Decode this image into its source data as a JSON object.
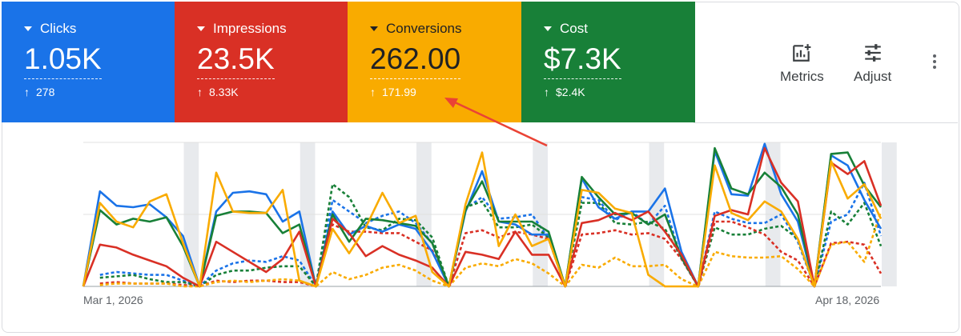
{
  "tiles": [
    {
      "label": "Clicks",
      "value": "1.05K",
      "delta": "278",
      "color": "#1a73e8"
    },
    {
      "label": "Impressions",
      "value": "23.5K",
      "delta": "8.33K",
      "color": "#d93025"
    },
    {
      "label": "Conversions",
      "value": "262.00",
      "delta": "171.99",
      "color": "#f9ab00"
    },
    {
      "label": "Cost",
      "value": "$7.3K",
      "delta": "$2.4K",
      "color": "#188038"
    }
  ],
  "toolbar": {
    "metrics_label": "Metrics",
    "adjust_label": "Adjust",
    "metrics_icon": "metrics-add-icon",
    "adjust_icon": "tune-icon",
    "more_icon": "more-vert-icon"
  },
  "chart_data": {
    "type": "line",
    "x_start_label": "Mar 1, 2026",
    "x_end_label": "Apr 18, 2026",
    "points": 49,
    "grid": true,
    "shaded_bands": "weekends",
    "series": [
      {
        "color": "#1a73e8",
        "style": "solid",
        "values": [
          0,
          0.66,
          0.56,
          0.55,
          0.57,
          0.48,
          0.35,
          0,
          0.52,
          0.65,
          0.66,
          0.64,
          0.45,
          0.52,
          0,
          0.52,
          0.36,
          0.42,
          0.38,
          0.43,
          0.4,
          0.24,
          0,
          0.52,
          0.8,
          0.45,
          0.43,
          0.36,
          0.36,
          0,
          0.75,
          0.55,
          0.47,
          0.52,
          0.52,
          0.68,
          0.24,
          0,
          0.94,
          0.64,
          0.63,
          0.99,
          0.64,
          0.45,
          0,
          0.91,
          0.84,
          0.6,
          0.4
        ]
      },
      {
        "color": "#188038",
        "style": "solid",
        "values": [
          0,
          0.53,
          0.43,
          0.47,
          0.45,
          0.48,
          0.28,
          0,
          0.49,
          0.52,
          0.52,
          0.51,
          0.37,
          0.43,
          0,
          0.5,
          0.31,
          0.47,
          0.46,
          0.44,
          0.42,
          0.3,
          0,
          0.53,
          0.73,
          0.45,
          0.45,
          0.45,
          0.38,
          0,
          0.76,
          0.62,
          0.5,
          0.51,
          0.43,
          0.5,
          0.2,
          0,
          0.96,
          0.68,
          0.64,
          0.79,
          0.69,
          0.5,
          0,
          0.92,
          0.93,
          0.7,
          0.55
        ]
      },
      {
        "color": "#d93025",
        "style": "solid",
        "values": [
          0,
          0.29,
          0.27,
          0.22,
          0.18,
          0.14,
          0.06,
          0,
          0.31,
          0.24,
          0.17,
          0.1,
          0.19,
          0.38,
          0,
          0.47,
          0.37,
          0.21,
          0.28,
          0.22,
          0.18,
          0.13,
          0,
          0.24,
          0.22,
          0.19,
          0.38,
          0.22,
          0.22,
          0,
          0.44,
          0.46,
          0.51,
          0.46,
          0.52,
          0.38,
          0.22,
          0,
          0.49,
          0.53,
          0.5,
          0.96,
          0.72,
          0.59,
          0,
          0.86,
          0.78,
          0.87,
          0.56
        ]
      },
      {
        "color": "#f9ab00",
        "style": "solid",
        "values": [
          0,
          0.58,
          0.45,
          0.41,
          0.59,
          0.64,
          0.3,
          0,
          0.79,
          0.52,
          0.51,
          0.51,
          0.67,
          0.04,
          0,
          0.4,
          0.23,
          0.41,
          0.65,
          0.44,
          0.49,
          0.1,
          0,
          0.57,
          0.93,
          0.28,
          0.5,
          0.28,
          0.33,
          0,
          0.67,
          0.65,
          0.54,
          0.51,
          0.08,
          0,
          0,
          0,
          0.84,
          0.51,
          0.46,
          0.59,
          0.52,
          0.33,
          0,
          0.87,
          0.61,
          0.71,
          0.47
        ]
      },
      {
        "color": "#1a73e8",
        "style": "dashed",
        "values": [
          null,
          0.08,
          0.1,
          0.09,
          0.08,
          0.08,
          0.04,
          0,
          0.11,
          0.16,
          0.18,
          0.17,
          0.21,
          0.18,
          0,
          0.6,
          0.52,
          0.44,
          0.49,
          0.52,
          0.44,
          0.3,
          0,
          0.54,
          0.62,
          0.47,
          0.48,
          0.5,
          0.33,
          0,
          0.62,
          0.6,
          0.46,
          0.52,
          0.43,
          0.56,
          0.19,
          0,
          0.52,
          0.47,
          0.44,
          0.44,
          0.5,
          0.31,
          0,
          0.45,
          0.5,
          0.72,
          0.35
        ]
      },
      {
        "color": "#188038",
        "style": "dashed",
        "values": [
          null,
          0.06,
          0.07,
          0.08,
          0.05,
          0.03,
          0.03,
          0,
          0.08,
          0.11,
          0.11,
          0.13,
          0.14,
          0.14,
          0,
          0.71,
          0.62,
          0.41,
          0.39,
          0.47,
          0.46,
          0.34,
          0,
          0.55,
          0.59,
          0.41,
          0.41,
          0.43,
          0.34,
          0,
          0.58,
          0.58,
          0.44,
          0.43,
          0.45,
          0.4,
          0.2,
          0,
          0.41,
          0.36,
          0.36,
          0.4,
          0.42,
          0.33,
          0,
          0.52,
          0.43,
          0.58,
          0.28
        ]
      },
      {
        "color": "#d93025",
        "style": "dashed",
        "values": [
          null,
          0.02,
          0.03,
          0.02,
          0.02,
          0.02,
          0.01,
          0,
          0.04,
          0.03,
          0.04,
          0.04,
          0.03,
          0.03,
          0,
          0.43,
          0.38,
          0.38,
          0.37,
          0.37,
          0.31,
          0.25,
          0,
          0.37,
          0.39,
          0.34,
          0.38,
          0.36,
          0.33,
          0,
          0.36,
          0.37,
          0.39,
          0.36,
          0.37,
          0.33,
          0.19,
          0,
          0.45,
          0.45,
          0.41,
          0.36,
          0.24,
          0.18,
          0,
          0.3,
          0.31,
          0.29,
          0.09
        ]
      },
      {
        "color": "#f9ab00",
        "style": "dashed",
        "values": [
          null,
          0.01,
          0.02,
          0.02,
          0.02,
          0.02,
          0.0,
          0,
          0.03,
          0.04,
          0.03,
          0.04,
          0.05,
          0.04,
          0,
          0.1,
          0.05,
          0.08,
          0.13,
          0.15,
          0.11,
          0.04,
          0,
          0.13,
          0.16,
          0.14,
          0.19,
          0.16,
          0.09,
          0,
          0.15,
          0.13,
          0.2,
          0.14,
          0.14,
          0.15,
          0.05,
          0,
          0.24,
          0.21,
          0.2,
          0.2,
          0.21,
          0.12,
          0,
          0.29,
          0.31,
          0.17,
          0.52
        ]
      }
    ]
  }
}
